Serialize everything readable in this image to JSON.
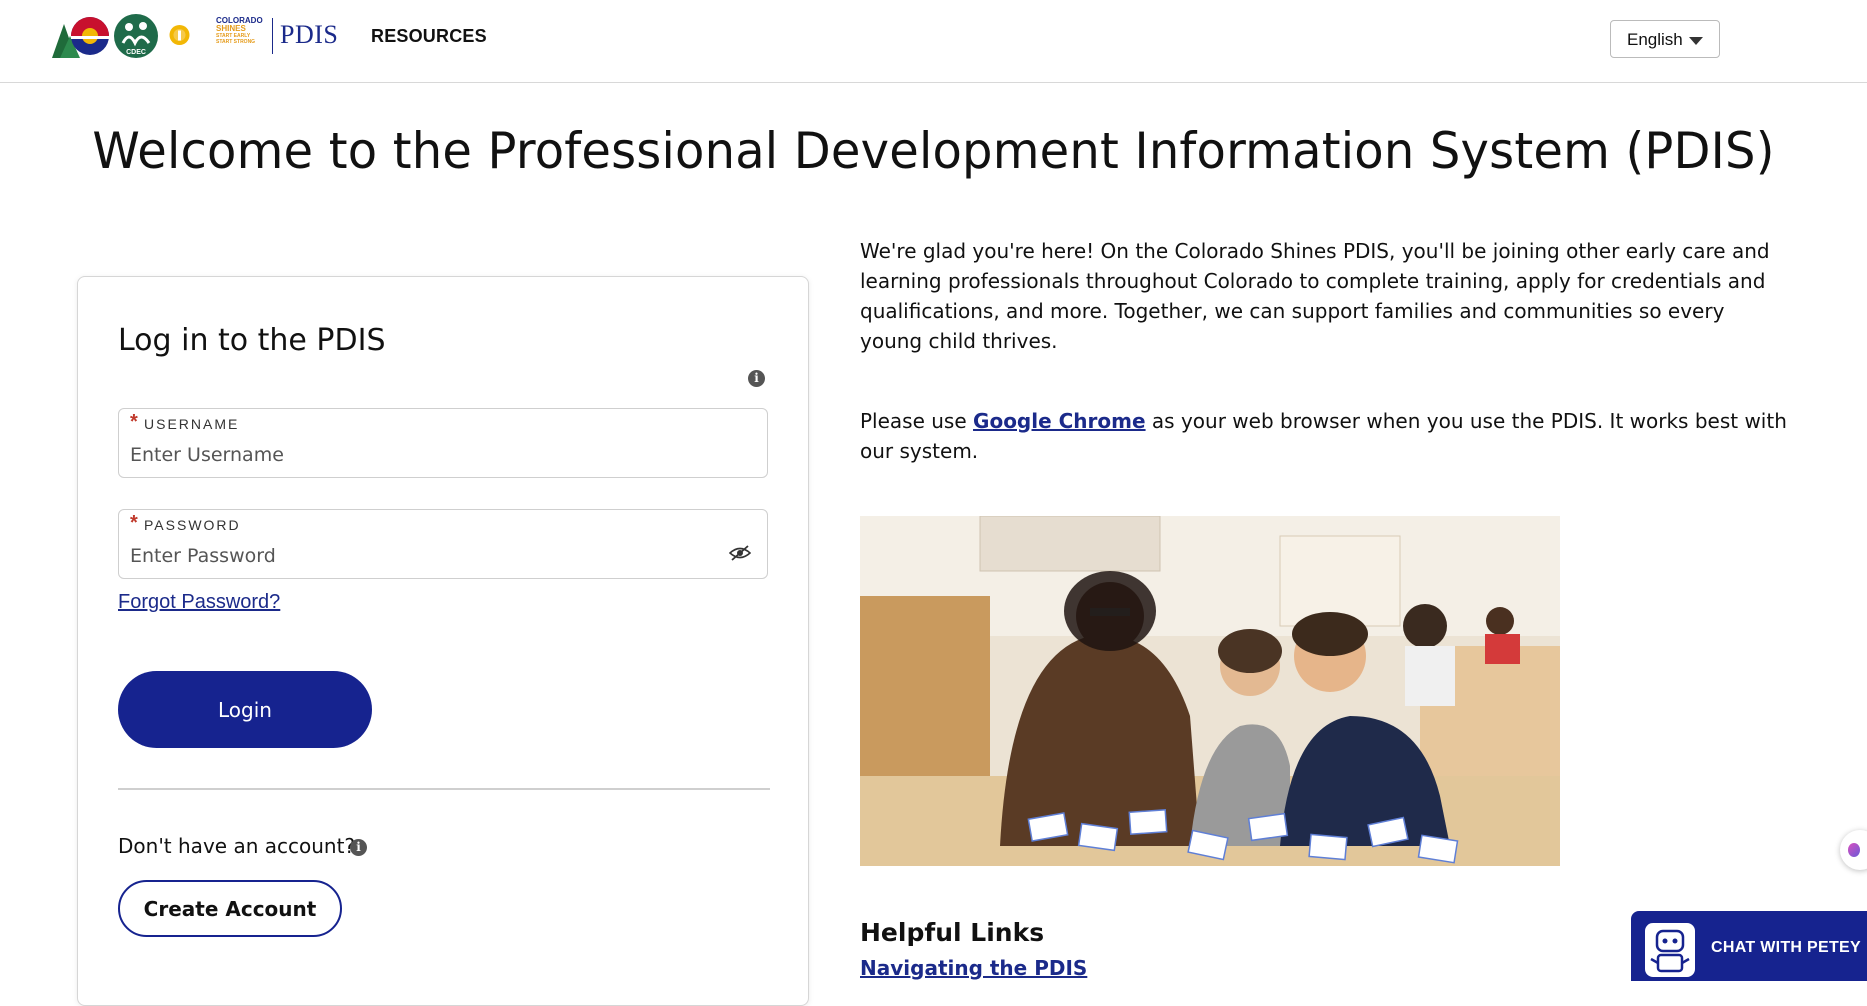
{
  "header": {
    "logo_shines_top": "COLORADO",
    "logo_shines_mid": "SHINES",
    "logo_shines_tag": "START EARLY START STRONG",
    "logo_cdec": "CDEC",
    "pdis_logo": "PDIS",
    "nav_resources": "RESOURCES",
    "language": "English"
  },
  "main": {
    "welcome_title": "Welcome to the Professional Development Information System (PDIS)"
  },
  "login": {
    "title": "Log in to the PDIS",
    "username_label": "USERNAME",
    "username_placeholder": "Enter Username",
    "password_label": "PASSWORD",
    "password_placeholder": "Enter Password",
    "required_mark": "*",
    "forgot_password": "Forgot Password?",
    "login_button": "Login",
    "no_account_text": "Don't have an account?",
    "create_account_button": "Create Account",
    "info_glyph": "i"
  },
  "intro": {
    "paragraph": "We're glad you're here! On the Colorado Shines PDIS, you'll be joining other early care and learning professionals throughout Colorado to complete training, apply for credentials and qualifications, and more. Together, we can support families and communities so every young child thrives.",
    "chrome_before": "Please use ",
    "chrome_link": "Google Chrome",
    "chrome_after": " as your web browser when you use the PDIS. It works best with our system."
  },
  "helpful": {
    "heading": "Helpful Links",
    "links": [
      "Navigating the PDIS"
    ]
  },
  "chat": {
    "label": "CHAT WITH PETEY"
  },
  "colors": {
    "brand_navy": "#16238f",
    "link_blue": "#1b2a8a",
    "required_red": "#c0392b"
  },
  "icons": {
    "info": "info-icon",
    "password_visibility": "eye-slash-icon",
    "language_caret": "chevron-down-icon",
    "chat_bot": "robot-icon"
  }
}
